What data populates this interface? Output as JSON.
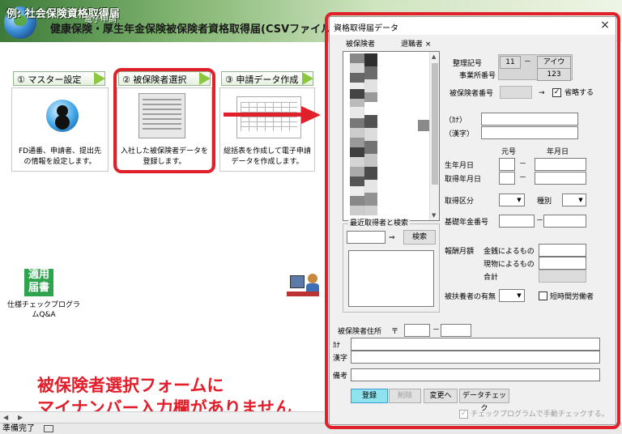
{
  "app": {
    "caption": "例: 社会保険資格取得届",
    "small_caption": "電子申請",
    "title": "健康保険・厚生年金保険被保険者資格取得届(CSVファイル添付方式"
  },
  "steps": [
    {
      "label": "① マスター設定",
      "desc": "FD通番、申請者、提出先の情報を設定します。"
    },
    {
      "label": "② 被保険者選択",
      "desc": "入社した被保険者データを登録します。"
    },
    {
      "label": "③ 申請データ作成",
      "desc": "総括表を作成して電子申請データを作成します。"
    }
  ],
  "desktop": {
    "tekiyo_icon_text": "適用届書",
    "tekiyo_label": "仕様チェックプログラムQ&A"
  },
  "caption": {
    "line1": "被保険者選択フォームに",
    "line2": "マイナンバー入力欄がありません"
  },
  "status": {
    "text": "準備完了"
  },
  "dialog": {
    "title": "資格取得届データ",
    "close": "×",
    "list_headers": {
      "insured": "被保険者",
      "retired": "退職者 ×"
    },
    "recent_group": "最近取得者と検索",
    "search_arrow": "⇒",
    "search_button": "検索",
    "labels": {
      "seiri_kigo": "整理記号",
      "jigyosho_bango": "事業所番号",
      "hihokensha_bango": "被保険者番号",
      "omit_arrow": "→",
      "omit": "省略する",
      "kana": "（ｶﾅ）",
      "kanji": "（漢字）",
      "gengo": "元号",
      "nengappi": "年月日",
      "birth": "生年月日",
      "acquire": "取得年月日",
      "acquire_type": "取得区分",
      "shubetsu": "種別",
      "pension_no": "基礎年金番号",
      "pay_label": "報酬月額",
      "pay_money": "金銭によるもの",
      "pay_kind": "現物によるもの",
      "pay_total": "合計",
      "dependents": "被扶養者の有無",
      "part_time": "短時間労働者",
      "address": "被保険者住所",
      "postal_mark": "〒",
      "addr_kana": "ｶﾅ",
      "addr_kanji": "漢字",
      "note": "備考",
      "dash": "－"
    },
    "values": {
      "seiri_num": "11",
      "seiri_kana": "アイウ",
      "jigyosho": "123"
    },
    "buttons": {
      "register": "登録",
      "delete": "削除",
      "change": "変更へ",
      "data_check": "データチェック"
    },
    "check_program": "チェックプログラムで手動チェックする。"
  }
}
